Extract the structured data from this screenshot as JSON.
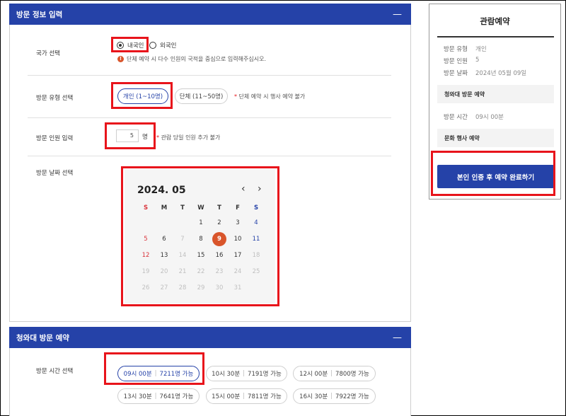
{
  "visit_info": {
    "header": "방문 정보 입력",
    "collapse": "—",
    "country": {
      "label": "국가 선택",
      "options": [
        "내국인",
        "외국인"
      ],
      "selected": "내국인",
      "note": "단체 예약 시 다수 인원의 국적을 중심으로 입력해주십시오.",
      "note_icon": "warning-icon"
    },
    "type": {
      "label": "방문 유형 선택",
      "options": [
        "개인 (1~10명)",
        "단체 (11~50명)"
      ],
      "selected": "개인 (1~10명)",
      "note_star": "*",
      "note": "단체 예약 시 행사 예약 불가"
    },
    "count": {
      "label": "방문 인원 입력",
      "value": "5",
      "unit": "명",
      "note_star": "*",
      "note": "관람 당일 인원 추가 불가"
    },
    "date": {
      "label": "방문 날짜 선택"
    }
  },
  "calendar": {
    "title": "2024. 05",
    "prev": "‹",
    "next": "›",
    "weekdays": [
      "S",
      "M",
      "T",
      "W",
      "T",
      "F",
      "S"
    ],
    "weeks": [
      [
        "",
        "",
        "",
        "1",
        "2",
        "3",
        "4"
      ],
      [
        "5",
        "6",
        "7",
        "8",
        "9",
        "10",
        "11"
      ],
      [
        "12",
        "13",
        "14",
        "15",
        "16",
        "17",
        "18"
      ],
      [
        "19",
        "20",
        "21",
        "22",
        "23",
        "24",
        "25"
      ],
      [
        "26",
        "27",
        "28",
        "29",
        "30",
        "31",
        ""
      ]
    ],
    "selected_day": "9",
    "colors": {
      "sunday": "#d9333b",
      "saturday": "#2542a8",
      "selected_bg": "#d9552b",
      "disabled": "#c0c0c0"
    }
  },
  "bluehouse": {
    "header": "청와대 방문 예약",
    "collapse": "—",
    "time_label": "방문 시간 선택",
    "slots": [
      {
        "time": "09시 00분",
        "avail": "7211명 가능"
      },
      {
        "time": "10시 30분",
        "avail": "7191명 가능"
      },
      {
        "time": "12시 00분",
        "avail": "7800명 가능"
      },
      {
        "time": "13시 30분",
        "avail": "7641명 가능"
      },
      {
        "time": "15시 00분",
        "avail": "7811명 가능"
      },
      {
        "time": "16시 30분",
        "avail": "7922명 가능"
      }
    ],
    "selected_slot": "09시 00분"
  },
  "side": {
    "title": "관람예약",
    "rows": [
      {
        "k": "방문 유형",
        "v": "개인"
      },
      {
        "k": "방문 인원",
        "v": "5"
      },
      {
        "k": "방문 날짜",
        "v": "2024년 05월 09일"
      }
    ],
    "band1": "청와대 방문 예약",
    "time_row": {
      "k": "방문 시간",
      "v": "09시 00분"
    },
    "band2": "문화 행사 예약",
    "button": "본인 인증 후 예약 완료하기"
  },
  "accent": "#2542a8",
  "highlight": "#e8141b"
}
